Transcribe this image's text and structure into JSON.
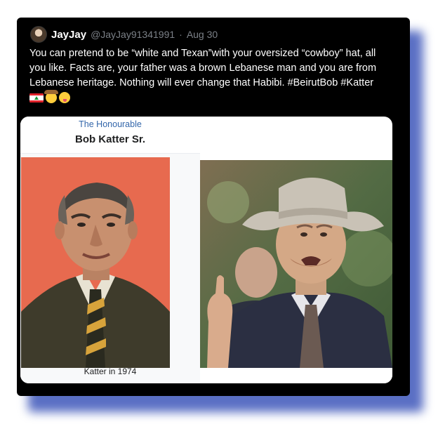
{
  "tweet": {
    "display_name": "JayJay",
    "handle": "@JayJay91341991",
    "separator": "·",
    "date": "Aug 30",
    "text": "You can pretend to be “white and Texan”with your oversized “cowboy” hat, all you like. Facts are, your father was a brown Lebanese man and you are from Lebanese heritage. Nothing will ever change that Habibi. #BeirutBob #Katter",
    "emojis": [
      "lebanon-flag",
      "cowboy-face",
      "winking-tongue-face"
    ]
  },
  "media": {
    "infobox_title": "The Honourable",
    "infobox_name": "Bob Katter Sr.",
    "left_caption": "Katter in 1974"
  },
  "colors": {
    "card_bg": "#000000",
    "shadow": "#5a6fc4",
    "link_blue": "#3366aa",
    "photo_bg": "#e76a4f"
  }
}
